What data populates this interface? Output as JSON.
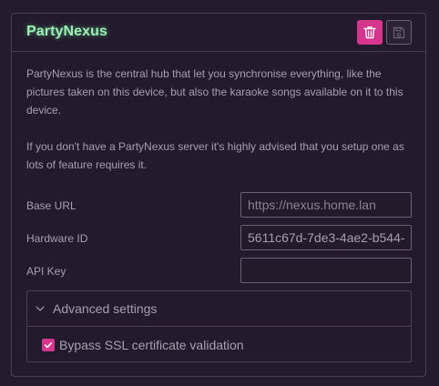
{
  "panel": {
    "title": "PartyNexus",
    "description_1": "PartyNexus is the central hub that let you synchronise everything, like the pictures taken on this device, but also the karaoke songs available on it to this device.",
    "description_2": "If you don't have a PartyNexus server it's highly advised that you setup one as lots of feature requires it."
  },
  "icons": {
    "delete": "trash-icon",
    "save": "floppy-disk-icon",
    "chevron": "chevron-down-icon",
    "check": "checkmark-icon"
  },
  "colors": {
    "accent": "#d6358d",
    "title_glow": "#9cf0b3",
    "background": "#251b2e",
    "text": "#a79fb0"
  },
  "fields": {
    "base_url": {
      "label": "Base URL",
      "value": "",
      "placeholder": "https://nexus.home.lan"
    },
    "hardware_id": {
      "label": "Hardware ID",
      "value": "5611c67d-7de3-4ae2-b544-",
      "placeholder": ""
    },
    "api_key": {
      "label": "API Key",
      "value": "",
      "placeholder": ""
    }
  },
  "advanced": {
    "title": "Advanced settings",
    "bypass_ssl": {
      "label": "Bypass SSL certificate validation",
      "checked": true
    }
  }
}
